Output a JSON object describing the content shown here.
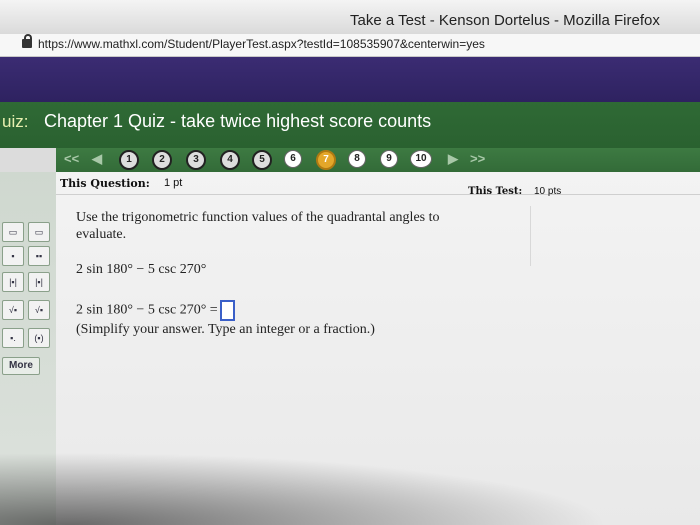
{
  "window": {
    "title": "Take a Test - Kenson Dortelus - Mozilla Firefox",
    "url": "https://www.mathxl.com/Student/PlayerTest.aspx?testId=108535907&centerwin=yes"
  },
  "quiz": {
    "label": "uiz:",
    "title": "Chapter 1 Quiz - take twice highest score counts"
  },
  "nav": {
    "first_arrow": "<<",
    "prev_arrow": "◀",
    "next_arrow": "▶",
    "last_arrow": ">>",
    "questions": [
      {
        "number": "1",
        "state": "answered"
      },
      {
        "number": "2",
        "state": "answered"
      },
      {
        "number": "3",
        "state": "answered"
      },
      {
        "number": "4",
        "state": "answered"
      },
      {
        "number": "5",
        "state": "answered"
      },
      {
        "number": "6",
        "state": "unanswered"
      },
      {
        "number": "7",
        "state": "current"
      },
      {
        "number": "8",
        "state": "unanswered"
      },
      {
        "number": "9",
        "state": "unanswered"
      },
      {
        "number": "10",
        "state": "unanswered"
      }
    ]
  },
  "info": {
    "this_question_label": "This Question:",
    "points": "1 pt",
    "this_test_label": "This Test:",
    "test_points": "10 pts"
  },
  "question": {
    "instruction_line1": "Use the trigonometric function values of the quadrantal angles to",
    "instruction_line2": "evaluate.",
    "expression": "2 sin 180° − 5 csc 270°",
    "answer_prompt": "2 sin 180° − 5 csc 270° =",
    "hint": "(Simplify your answer. Type an integer or a fraction.)"
  },
  "tools": {
    "more_label": "More"
  },
  "colors": {
    "header_green": "#2f6a35",
    "purple_band": "#3b2c73",
    "current_question": "#e4a72a",
    "answer_box_border": "#3a5fc8"
  }
}
